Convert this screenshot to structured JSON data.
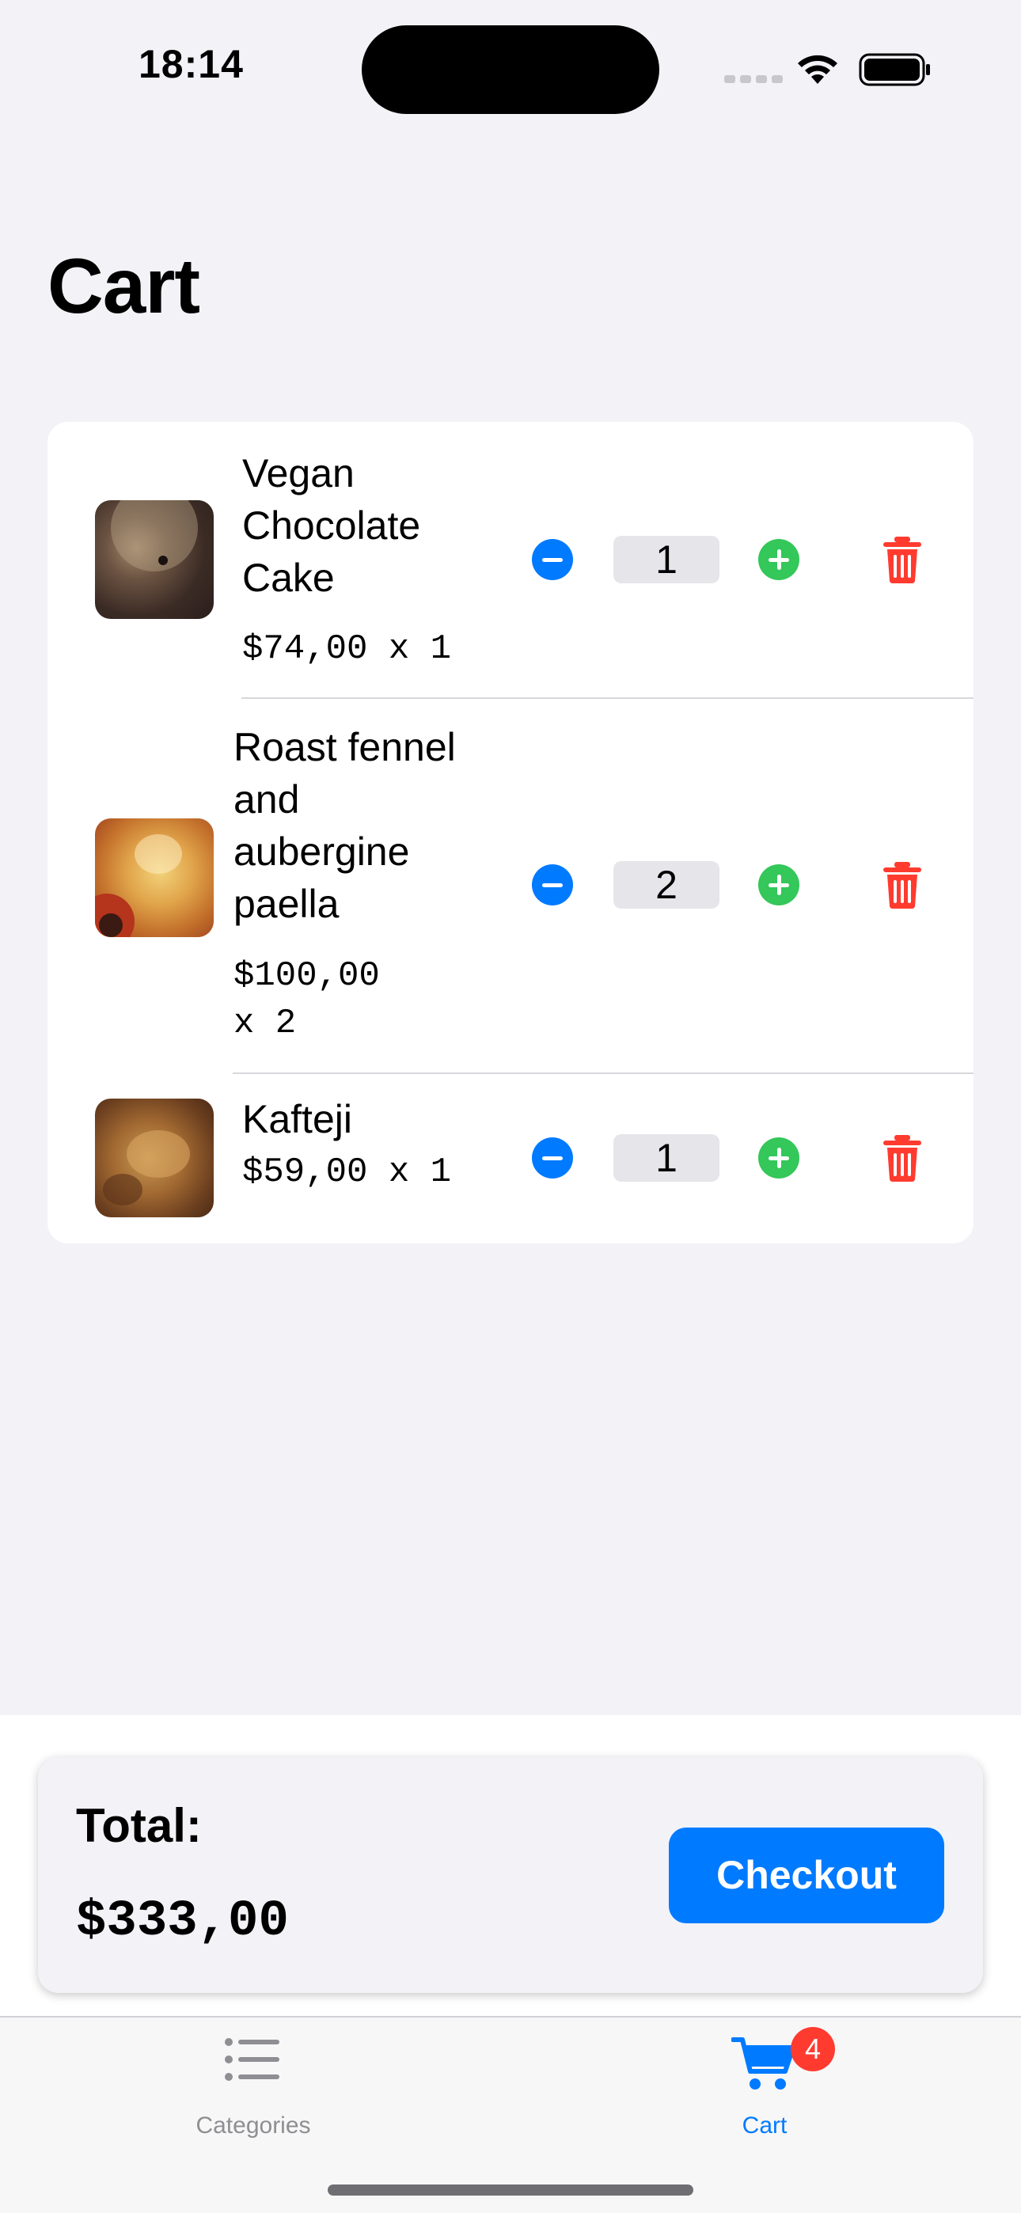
{
  "status_bar": {
    "time": "18:14"
  },
  "title": "Cart",
  "items": [
    {
      "name": "Vegan Chocolate Cake",
      "name_lines": [
        "Vegan",
        "Chocolate",
        "Cake"
      ],
      "price_lines": [
        "$74,00 x 1"
      ],
      "quantity": "1"
    },
    {
      "name": "Roast fennel and aubergine paella",
      "name_lines": [
        "Roast fennel",
        "and",
        "aubergine",
        "paella"
      ],
      "price_lines": [
        "$100,00",
        "x 2"
      ],
      "quantity": "2"
    },
    {
      "name": "Kafteji",
      "name_lines": [
        "Kafteji"
      ],
      "price_lines": [
        "$59,00 x 1"
      ],
      "quantity": "1"
    }
  ],
  "summary": {
    "total_label": "Total:",
    "total_value": "$333,00",
    "checkout_label": "Checkout"
  },
  "tabbar": {
    "categories_label": "Categories",
    "cart_label": "Cart",
    "cart_badge": "4"
  },
  "colors": {
    "accent": "#007aff",
    "plus": "#34c759",
    "delete": "#ff3b30"
  }
}
